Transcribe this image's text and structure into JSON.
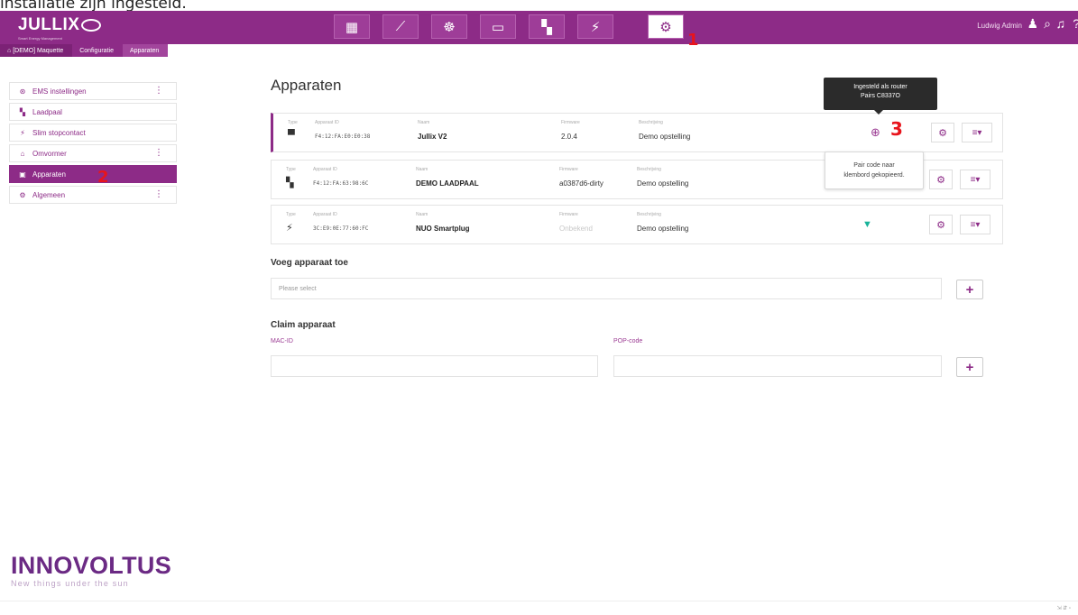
{
  "caption": "installatie zijn ingesteld.",
  "topbar": {
    "logo": "JULLIX",
    "logo_sub": "Smart Energy Management",
    "nav": [
      {
        "icon": "dashboard-icon",
        "glyph": "▦"
      },
      {
        "icon": "chart-icon",
        "glyph": "⟋"
      },
      {
        "icon": "brain-icon",
        "glyph": "☸"
      },
      {
        "icon": "battery-icon",
        "glyph": "▭"
      },
      {
        "icon": "charger-icon",
        "glyph": "▚"
      },
      {
        "icon": "plug-icon",
        "glyph": "⚡"
      },
      {
        "icon": "gear-icon",
        "glyph": "⚙"
      }
    ],
    "user": "Ludwig Admin",
    "user_icon": "user-icon",
    "search_icon": "search-icon",
    "bell_icon": "bell-icon",
    "help_icon": "help-icon"
  },
  "breadcrumb": [
    "[DEMO] Maquette",
    "Configuratie",
    "Apparaten"
  ],
  "sidebar": {
    "items": [
      {
        "label": "EMS instellingen",
        "icon": "ems-icon",
        "glyph": "⊛",
        "dots": "⋮"
      },
      {
        "label": "Laadpaal",
        "icon": "charger-icon",
        "glyph": "▚",
        "dots": ""
      },
      {
        "label": "Slim stopcontact",
        "icon": "plug-icon",
        "glyph": "⚡",
        "dots": ""
      },
      {
        "label": "Omvormer",
        "icon": "inverter-icon",
        "glyph": "⌂",
        "dots": "⋮"
      },
      {
        "label": "Apparaten",
        "icon": "devices-icon",
        "glyph": "▣",
        "dots": ""
      },
      {
        "label": "Algemeen",
        "icon": "gear-icon",
        "glyph": "⚙",
        "dots": "⋮"
      }
    ],
    "active_index": 4
  },
  "brand": {
    "name": "INNOVOLTUS",
    "tagline": "New things under the sun"
  },
  "main": {
    "title": "Apparaten",
    "labels": {
      "type": "Type",
      "id": "Apparaat ID",
      "name": "Naam",
      "firmware": "Firmware",
      "desc": "Beschrijving"
    },
    "devices": [
      {
        "type_icon": "router-icon",
        "glyph": "▀",
        "id": "F4:12:FA:E0:E0:38",
        "name": "Jullix V2",
        "firmware": "2.0.4",
        "desc": "Demo opstelling",
        "status_icon": "network-icon",
        "status_glyph": "⊕"
      },
      {
        "type_icon": "charger-icon",
        "glyph": "▚",
        "id": "F4:12:FA:63:98:6C",
        "name": "DEMO LAADPAAL",
        "firmware": "a0387d6-dirty",
        "desc": "Demo opstelling",
        "status_icon": "",
        "status_glyph": ""
      },
      {
        "type_icon": "plug-icon",
        "glyph": "⚡",
        "id": "3C:E9:0E:77:60:FC",
        "name": "NUO Smartplug",
        "firmware": "Onbekend",
        "desc": "Demo opstelling",
        "status_icon": "wifi-icon",
        "status_glyph": "▼"
      }
    ],
    "tooltip_dark": [
      "Ingesteld als router",
      "Pairs C8337O"
    ],
    "tooltip_light": [
      "Pair code naar",
      "klembord gekopieerd."
    ],
    "add_section": "Voeg apparaat toe",
    "add_placeholder": "Please select",
    "claim_section": "Claim apparaat",
    "mac_label": "MAC-ID",
    "pop_label": "POP-code",
    "plus": "+"
  },
  "markers": [
    "1",
    "2",
    "3"
  ],
  "corner_text": "⇲ ⇵ ▫"
}
